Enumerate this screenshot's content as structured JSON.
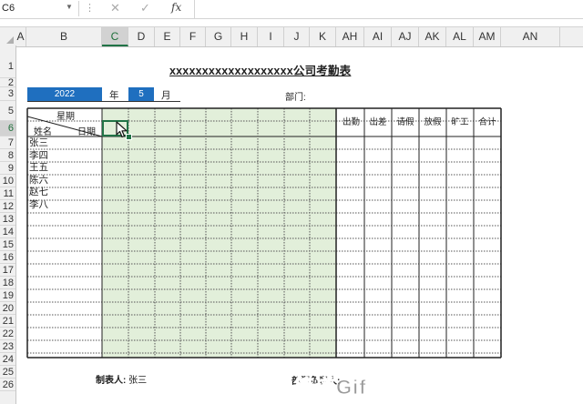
{
  "formula_bar": {
    "name_box": "C6",
    "cancel_icon": "✕",
    "enter_icon": "✓",
    "fx_label": "fx",
    "formula": ""
  },
  "columns": [
    "A",
    "B",
    "C",
    "D",
    "E",
    "F",
    "G",
    "H",
    "I",
    "J",
    "K",
    "AH",
    "AI",
    "AJ",
    "AK",
    "AL",
    "AM",
    "AN"
  ],
  "rows": [
    "1",
    "2",
    "3",
    "5",
    "6",
    "7",
    "8",
    "9",
    "10",
    "11",
    "12",
    "13",
    "14",
    "15",
    "16",
    "17",
    "18",
    "19",
    "20",
    "21",
    "22",
    "23",
    "24",
    "25",
    "26"
  ],
  "selected_cell": "C6",
  "sheet": {
    "title": "xxxxxxxxxxxxxxxxxxx公司考勤表",
    "year": "2022",
    "year_label": "年",
    "month": "5",
    "month_label": "月",
    "dept_label": "部门:",
    "header_week": "星期",
    "header_date": "日期",
    "header_name": "姓名",
    "summary_headers": [
      "出勤",
      "出差",
      "请假",
      "放假",
      "旷工",
      "合计"
    ],
    "employees": [
      "张三",
      "李四",
      "王五",
      "陈六",
      "赵七",
      "李八"
    ],
    "maker_label": "制表人:",
    "maker_name": "张三",
    "dept_footer": "部门负责人:"
  },
  "watermark": "简道Gif动图",
  "colors": {
    "accent_blue": "#1f6fbf",
    "green_fill": "#e2efda",
    "excel_green": "#217346"
  }
}
